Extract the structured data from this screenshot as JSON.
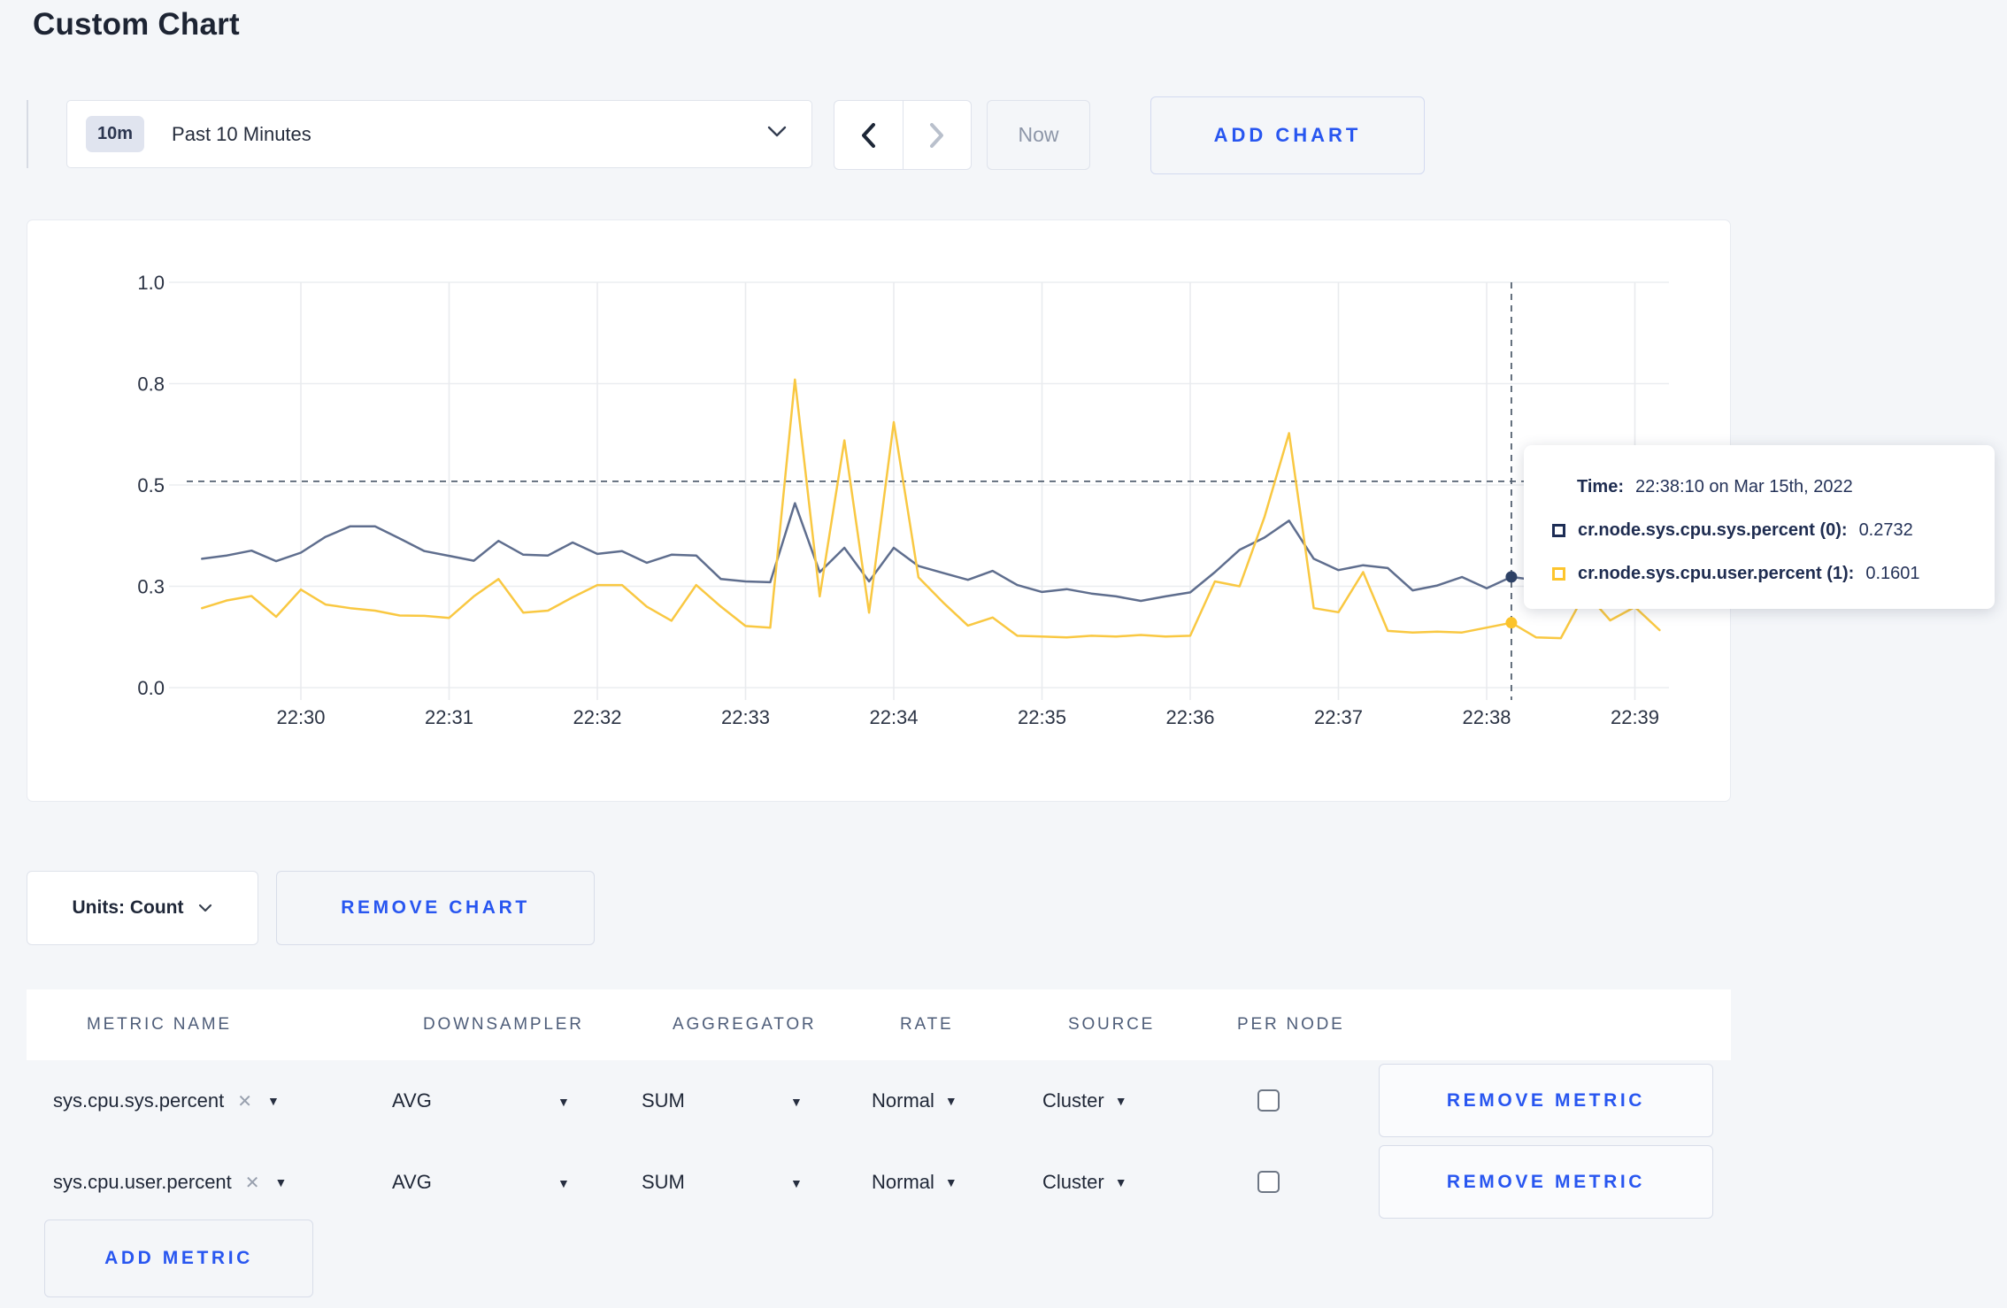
{
  "page": {
    "title": "Custom Chart"
  },
  "toolbar": {
    "range_badge": "10m",
    "range_label": "Past 10 Minutes",
    "now_label": "Now",
    "add_chart_label": "ADD CHART"
  },
  "chart_controls": {
    "units_label": "Units: Count",
    "remove_chart_label": "REMOVE CHART"
  },
  "tooltip": {
    "time_label": "Time:",
    "time_value": "22:38:10 on Mar 15th, 2022",
    "series": [
      {
        "label": "cr.node.sys.cpu.sys.percent (0):",
        "value": "0.2732",
        "color": "#1d2d55"
      },
      {
        "label": "cr.node.sys.cpu.user.percent (1):",
        "value": "0.1601",
        "color": "#fdc52d"
      }
    ]
  },
  "metrics_table": {
    "headers": [
      "METRIC NAME",
      "DOWNSAMPLER",
      "AGGREGATOR",
      "RATE",
      "SOURCE",
      "PER NODE"
    ],
    "remove_metric_label": "REMOVE METRIC",
    "add_metric_label": "ADD METRIC",
    "rows": [
      {
        "metric": "sys.cpu.sys.percent",
        "remove_icon": "✕",
        "downsampler": "AVG",
        "aggregator": "SUM",
        "rate": "Normal",
        "source": "Cluster",
        "per_node_checked": false
      },
      {
        "metric": "sys.cpu.user.percent",
        "remove_icon": "✕",
        "downsampler": "AVG",
        "aggregator": "SUM",
        "rate": "Normal",
        "source": "Cluster",
        "per_node_checked": false
      }
    ]
  },
  "chart_data": {
    "type": "line",
    "x_start": "22:29:20",
    "x_interval_seconds": 10,
    "x_tick_labels": [
      "22:30",
      "22:31",
      "22:32",
      "22:33",
      "22:34",
      "22:35",
      "22:36",
      "22:37",
      "22:38",
      "22:39"
    ],
    "y_tick_values": [
      0,
      0.25,
      0.5,
      0.75,
      1.0
    ],
    "y_tick_labels": [
      "0.0",
      "0.3",
      "0.5",
      "0.8",
      "1.0"
    ],
    "ylim": [
      0,
      1
    ],
    "grid": true,
    "legend_position": "none",
    "series": [
      {
        "name": "cr.node.sys.cpu.sys.percent",
        "color": "#5f6e8e",
        "values": [
          0.318,
          0.326,
          0.338,
          0.312,
          0.333,
          0.372,
          0.398,
          0.398,
          0.368,
          0.337,
          0.325,
          0.313,
          0.362,
          0.328,
          0.326,
          0.358,
          0.33,
          0.337,
          0.308,
          0.328,
          0.326,
          0.268,
          0.262,
          0.26,
          0.455,
          0.285,
          0.345,
          0.262,
          0.345,
          0.3,
          0.283,
          0.266,
          0.288,
          0.253,
          0.236,
          0.243,
          0.232,
          0.225,
          0.214,
          0.225,
          0.235,
          0.285,
          0.34,
          0.37,
          0.412,
          0.318,
          0.29,
          0.302,
          0.295,
          0.24,
          0.252,
          0.273,
          0.245,
          0.2732,
          0.265,
          0.262,
          0.266,
          0.27,
          0.268,
          0.265
        ]
      },
      {
        "name": "cr.node.sys.cpu.user.percent",
        "color": "#f9c842",
        "values": [
          0.196,
          0.215,
          0.226,
          0.175,
          0.242,
          0.205,
          0.196,
          0.19,
          0.178,
          0.177,
          0.172,
          0.225,
          0.268,
          0.185,
          0.19,
          0.223,
          0.253,
          0.253,
          0.2,
          0.165,
          0.253,
          0.2,
          0.152,
          0.148,
          0.76,
          0.225,
          0.61,
          0.185,
          0.655,
          0.272,
          0.21,
          0.153,
          0.173,
          0.128,
          0.126,
          0.124,
          0.128,
          0.126,
          0.13,
          0.126,
          0.128,
          0.262,
          0.25,
          0.42,
          0.628,
          0.196,
          0.186,
          0.285,
          0.14,
          0.136,
          0.138,
          0.136,
          0.148,
          0.1601,
          0.124,
          0.122,
          0.235,
          0.166,
          0.199,
          0.142
        ]
      }
    ],
    "crosshair": {
      "time": "22:38:10",
      "x_index": 53,
      "y_value": 0.509,
      "points": [
        {
          "value": 0.2732,
          "dot_color": "#2e4266"
        },
        {
          "value": 0.1601,
          "dot_color": "#fbc32b"
        }
      ]
    }
  }
}
